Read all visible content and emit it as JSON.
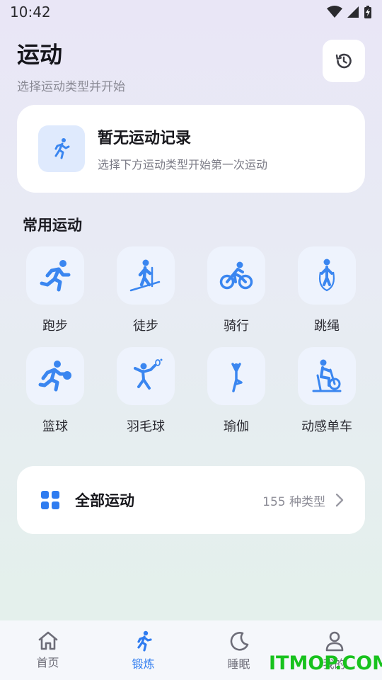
{
  "status": {
    "time": "10:42"
  },
  "header": {
    "title": "运动",
    "subtitle": "选择运动类型并开始"
  },
  "history": {
    "icon": "history-icon"
  },
  "empty_record": {
    "title": "暂无运动记录",
    "subtitle": "选择下方运动类型开始第一次运动",
    "icon": "running-icon"
  },
  "common": {
    "title": "常用运动",
    "items": [
      {
        "label": "跑步",
        "icon": "running-icon"
      },
      {
        "label": "徒步",
        "icon": "hiking-icon"
      },
      {
        "label": "骑行",
        "icon": "cycling-icon"
      },
      {
        "label": "跳绳",
        "icon": "jump-rope-icon"
      },
      {
        "label": "篮球",
        "icon": "basketball-icon"
      },
      {
        "label": "羽毛球",
        "icon": "badminton-icon"
      },
      {
        "label": "瑜伽",
        "icon": "yoga-icon"
      },
      {
        "label": "动感单车",
        "icon": "spin-bike-icon"
      }
    ]
  },
  "all_sports": {
    "title": "全部运动",
    "count": "155 种类型",
    "icon": "grid-icon"
  },
  "tabs": [
    {
      "label": "首页",
      "icon": "home-icon",
      "active": false
    },
    {
      "label": "锻炼",
      "icon": "exercise-icon",
      "active": true
    },
    {
      "label": "睡眠",
      "icon": "moon-icon",
      "active": false
    },
    {
      "label": "我的",
      "icon": "person-icon",
      "active": false
    }
  ],
  "watermark": "ITMOP.COM",
  "colors": {
    "accent": "#2f7cf0",
    "icon_blue": "#3a86f0",
    "watermark": "#18c21d"
  }
}
